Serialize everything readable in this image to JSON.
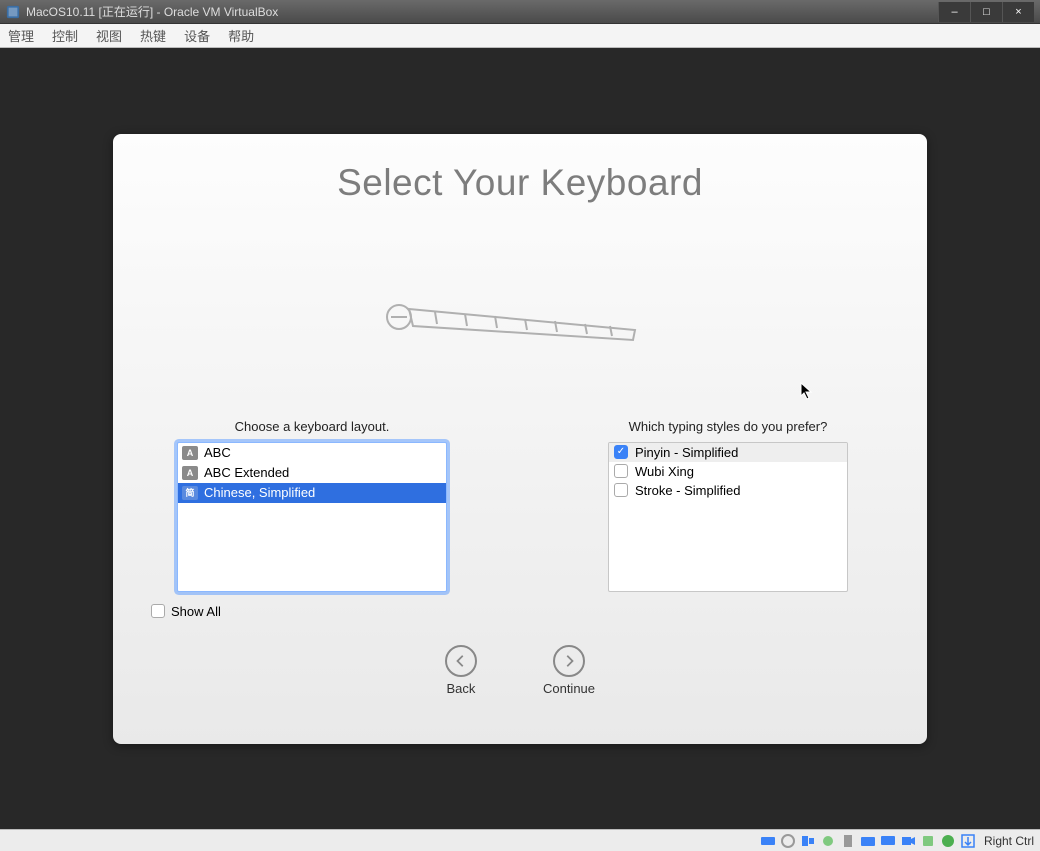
{
  "window": {
    "title": "MacOS10.11 [正在运行] - Oracle VM VirtualBox",
    "min_label": "–",
    "max_label": "□",
    "close_label": "×"
  },
  "vb_menu": {
    "items": [
      "管理",
      "控制",
      "视图",
      "热键",
      "设备",
      "帮助"
    ]
  },
  "setup": {
    "title": "Select Your Keyboard",
    "layout_label": "Choose a keyboard layout.",
    "typing_label": "Which typing styles do you prefer?",
    "layouts": [
      {
        "icon": "A",
        "label": "ABC",
        "selected": false
      },
      {
        "icon": "A",
        "label": "ABC Extended",
        "selected": false
      },
      {
        "icon": "简",
        "label": "Chinese, Simplified",
        "selected": true
      }
    ],
    "typing_styles": [
      {
        "label": "Pinyin - Simplified",
        "checked": true
      },
      {
        "label": "Wubi Xing",
        "checked": false
      },
      {
        "label": "Stroke - Simplified",
        "checked": false
      }
    ],
    "show_all_label": "Show All",
    "show_all_checked": false,
    "back_label": "Back",
    "continue_label": "Continue"
  },
  "statusbar": {
    "host_key": "Right Ctrl"
  }
}
